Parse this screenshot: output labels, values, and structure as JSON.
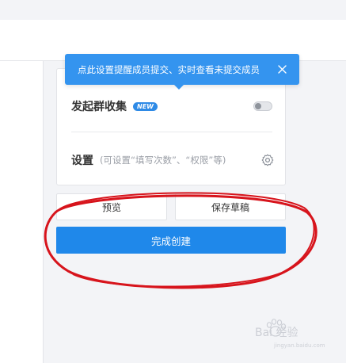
{
  "tooltip": {
    "text": "点此设置提醒成员提交、实时查看未提交成员"
  },
  "group_collect": {
    "title": "发起群收集",
    "badge": "NEW"
  },
  "settings_row": {
    "title": "设置",
    "hint": "(可设置“填写次数”、“权限”等)"
  },
  "buttons": {
    "preview": "预览",
    "save_draft": "保存草稿",
    "finish": "完成创建"
  },
  "watermark": {
    "text": "Bai 经验",
    "sub": "jingyan.baidu.com"
  },
  "colors": {
    "accent": "#1f88ea",
    "tooltip": "#3494ef",
    "annotation": "#d7141c"
  }
}
